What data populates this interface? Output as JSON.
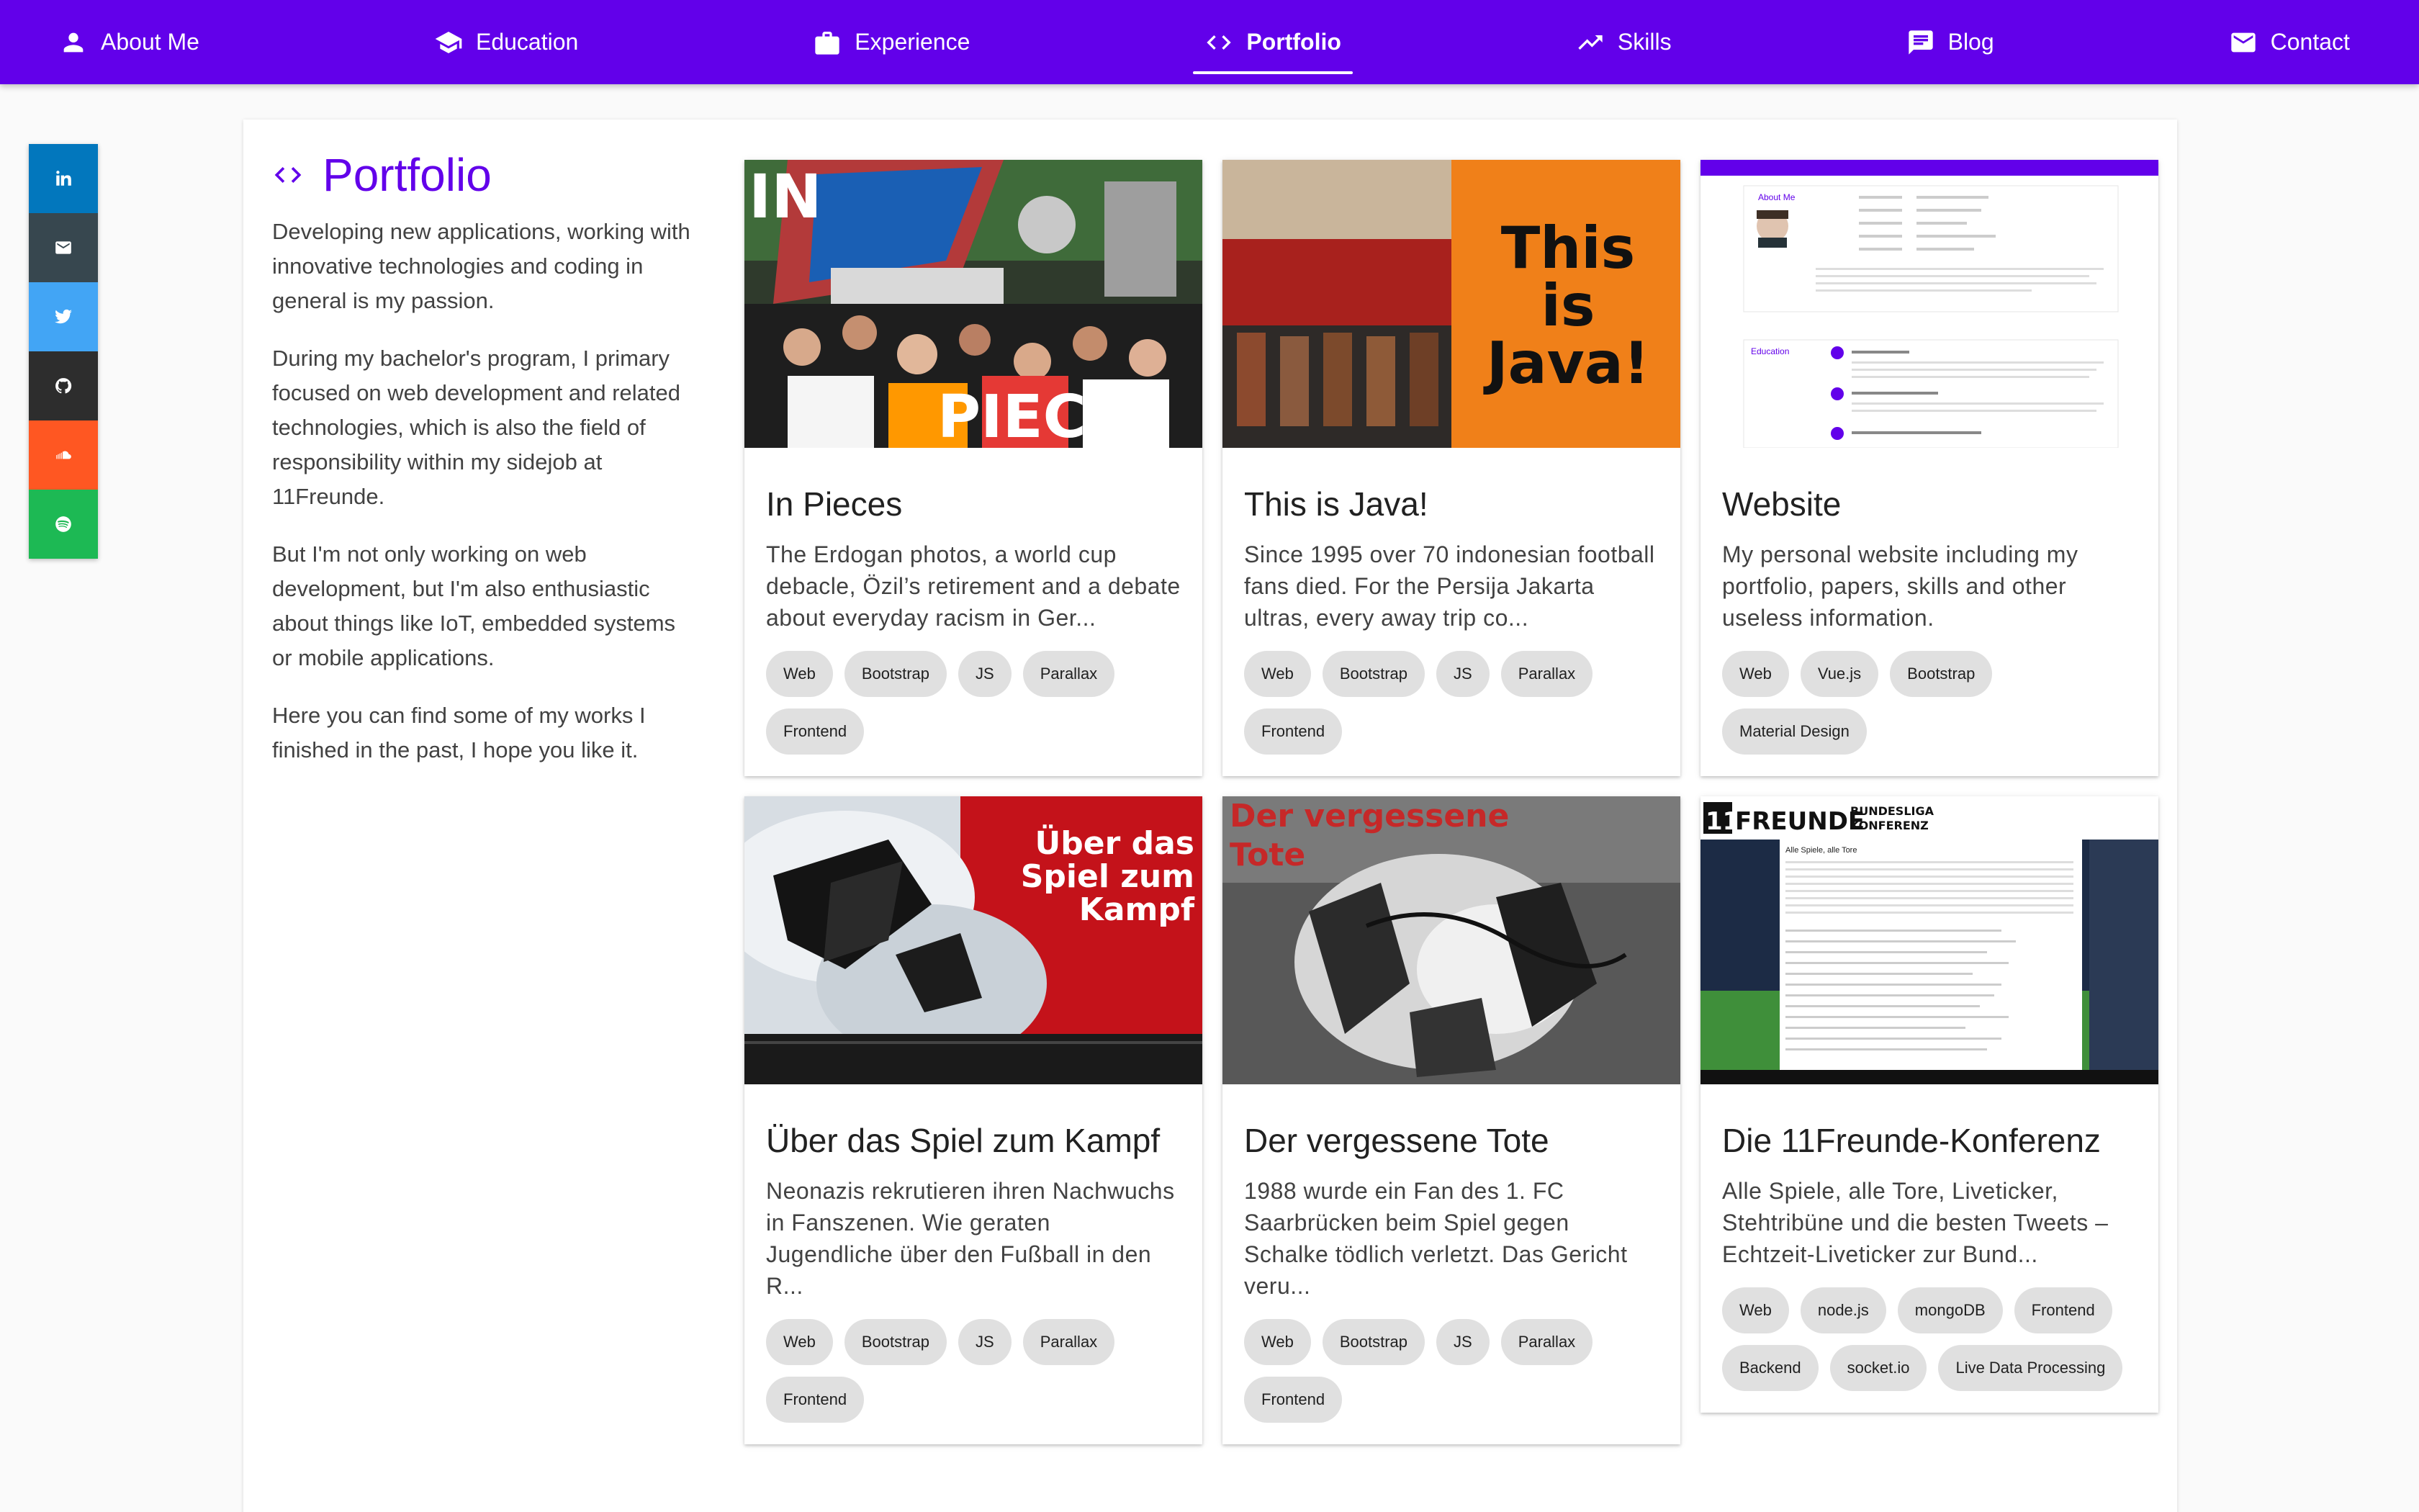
{
  "nav": {
    "items": [
      {
        "label": "About Me",
        "icon": "person-icon"
      },
      {
        "label": "Education",
        "icon": "school-icon"
      },
      {
        "label": "Experience",
        "icon": "briefcase-icon"
      },
      {
        "label": "Portfolio",
        "icon": "code-icon",
        "active": true
      },
      {
        "label": "Skills",
        "icon": "trending-up-icon"
      },
      {
        "label": "Blog",
        "icon": "comment-icon"
      },
      {
        "label": "Contact",
        "icon": "mail-icon"
      }
    ],
    "color": "#6200ea"
  },
  "social": [
    {
      "name": "linkedin-icon",
      "color": "#0277bd"
    },
    {
      "name": "email-icon",
      "color": "#37474f"
    },
    {
      "name": "twitter-icon",
      "color": "#42a5f5"
    },
    {
      "name": "github-icon",
      "color": "#2d2d2d"
    },
    {
      "name": "soundcloud-icon",
      "color": "#ff5722"
    },
    {
      "name": "spotify-icon",
      "color": "#1db954"
    }
  ],
  "intro": {
    "title": "Portfolio",
    "paragraphs": [
      "Developing new applications, working with innovative technologies and coding in general is my passion.",
      "During my bachelor's program, I primary focused on web development and related technologies, which is also the field of responsibility within my sidejob at 11Freunde.",
      "But I'm not only working on web development, but I'm also enthusiastic about things like IoT, embedded systems or mobile applications.",
      "Here you can find some of my works I finished in the past, I hope you like it."
    ]
  },
  "projects": [
    {
      "title": "In Pieces",
      "description": "The Erdogan photos, a world cup debacle, Özil’s retirement and a debate about everyday racism in Ger...",
      "tags": [
        "Web",
        "Bootstrap",
        "JS",
        "Parallax",
        "Frontend"
      ],
      "thumb_text": [
        "IN",
        "PIECES"
      ]
    },
    {
      "title": "This is Java!",
      "description": "Since 1995 over 70 indonesian football fans died. For the Persija Jakarta ultras, every away trip co...",
      "tags": [
        "Web",
        "Bootstrap",
        "JS",
        "Parallax",
        "Frontend"
      ],
      "thumb_text": [
        "This",
        "is",
        "Java!"
      ]
    },
    {
      "title": "Website",
      "description": "My personal website including my portfolio, papers, skills and other useless information.",
      "tags": [
        "Web",
        "Vue.js",
        "Bootstrap",
        "Material Design"
      ],
      "thumb_text": [
        "About Me",
        "Education"
      ]
    },
    {
      "title": "Über das Spiel zum Kampf",
      "description": "Neonazis rekrutieren ihren Nachwuchs in Fanszenen. Wie geraten Jugendliche über den Fußball in den R...",
      "tags": [
        "Web",
        "Bootstrap",
        "JS",
        "Parallax",
        "Frontend"
      ],
      "thumb_text": [
        "Über das",
        "Spiel zum",
        "Kampf"
      ]
    },
    {
      "title": "Der vergessene Tote",
      "description": "1988 wurde ein Fan des 1. FC Saarbrücken beim Spiel gegen Schalke tödlich verletzt. Das Gericht veru...",
      "tags": [
        "Web",
        "Bootstrap",
        "JS",
        "Parallax",
        "Frontend"
      ],
      "thumb_text": [
        "Der vergessene",
        "Tote"
      ]
    },
    {
      "title": "Die 11Freunde-Konferenz",
      "description": "Alle Spiele, alle Tore, Liveticker, Stehtribüne und die besten Tweets – Echtzeit-Liveticker zur Bund...",
      "tags": [
        "Web",
        "node.js",
        "mongoDB",
        "Frontend",
        "Backend",
        "socket.io",
        "Live Data Processing"
      ],
      "thumb_text": [
        "11",
        "FREUNDE",
        "BUNDESLIGA",
        "KONFERENZ",
        "Alle Spiele, alle Tore"
      ]
    }
  ]
}
